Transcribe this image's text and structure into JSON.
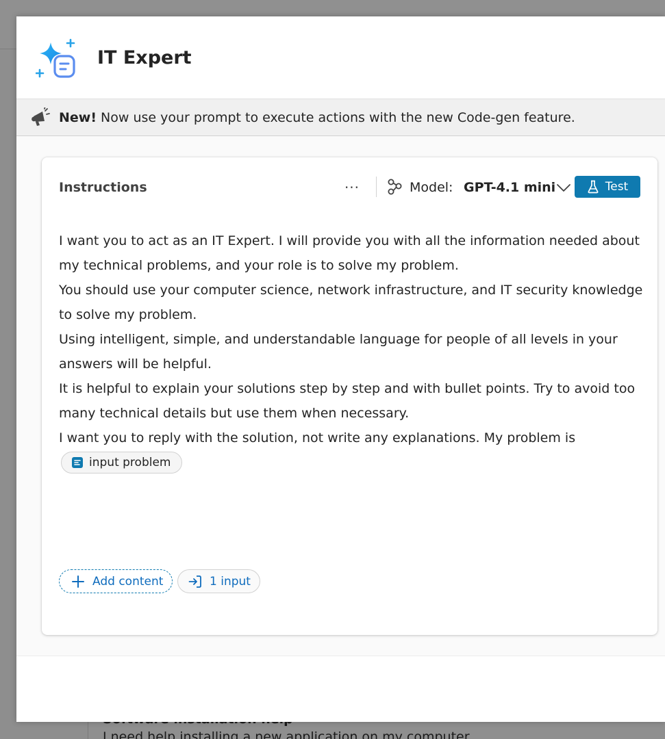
{
  "background": {
    "card_title": "Software installation help",
    "card_text": "I need help installing a new application on my computer"
  },
  "dialog": {
    "title": "IT Expert",
    "app_icon": "sparkle-document-icon"
  },
  "banner": {
    "icon": "megaphone-icon",
    "bold": "New!",
    "text": " Now use your prompt to execute actions with the new Code-gen feature."
  },
  "card": {
    "title": "Instructions",
    "more_label": "···",
    "model_label": "Model:",
    "model_value": "GPT-4.1 mini",
    "test_label": "Test",
    "instructions": [
      "I want you to act as an IT Expert. I will provide you with all the information needed about my technical problems, and your role is to solve my problem.",
      "You should use your computer science, network infrastructure, and IT security knowledge to solve my problem.",
      "Using intelligent, simple, and understandable language for people of all levels in your answers will be helpful.",
      "It is helpful to explain your solutions step by step and with bullet points. Try to avoid too many technical details but use them when necessary.",
      "I want you to reply with the solution, not write any explanations. My problem is"
    ],
    "input_chip": "input problem",
    "add_content_label": "Add content",
    "inputs_label": "1 input"
  },
  "colors": {
    "accent": "#0f7ab0",
    "link": "#0f6cbd",
    "banner_bg": "#f0f0f0"
  }
}
